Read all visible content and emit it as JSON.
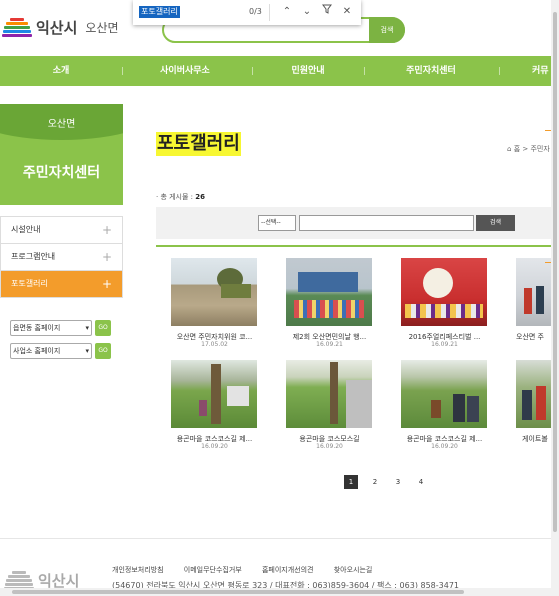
{
  "header": {
    "city": "익산시",
    "town": "오산면",
    "search_button": "검색"
  },
  "findbar": {
    "query": "포토갤러리",
    "count": "0/3"
  },
  "nav": [
    "소개",
    "사이버사무소",
    "민원안내",
    "주민자치센터",
    "커뮤"
  ],
  "sidebar": {
    "subtitle": "오산면",
    "title": "주민자치센터",
    "items": [
      "시설안내",
      "프로그램안내",
      "포토갤러리"
    ],
    "quick_links": [
      {
        "label": "읍면동 홈페이지",
        "go": "GO"
      },
      {
        "label": "사업소 홈페이지",
        "go": "GO"
      }
    ]
  },
  "main": {
    "title": "포토갤러리",
    "breadcrumb": "홈 > 주민자",
    "count_label": "· 총 게시물 :",
    "count_value": "26",
    "select_label": "--선택--",
    "search_button": "검색"
  },
  "gallery": [
    {
      "caption": "오산면 주민자치위원 코...",
      "date": "17.05.02"
    },
    {
      "caption": "제2회 오산면민의날 행...",
      "date": "16.09.21"
    },
    {
      "caption": "2016주얼리페스티벌 ...",
      "date": "16.09.21"
    },
    {
      "caption": "오산면 주",
      "date": ""
    },
    {
      "caption": "용곤마을 코스코스길 제...",
      "date": "16.09.20"
    },
    {
      "caption": "용곤마을 코스모스길",
      "date": "16.09.20"
    },
    {
      "caption": "용곤마을 코스코스길 제...",
      "date": "16.09.20"
    },
    {
      "caption": "게이트볼",
      "date": ""
    }
  ],
  "pagination": [
    "1",
    "2",
    "3",
    "4"
  ],
  "footer": {
    "city": "익산시",
    "links": [
      "개인정보처리방침",
      "이메일무단수집거부",
      "홈페이지개선의견",
      "찾아오시는길"
    ],
    "address": "(54670) 전라북도 익산시 오산면 평동로 323 / 대표전화 : 063)859-3604 / 팩스 : 063) 858-3471"
  }
}
